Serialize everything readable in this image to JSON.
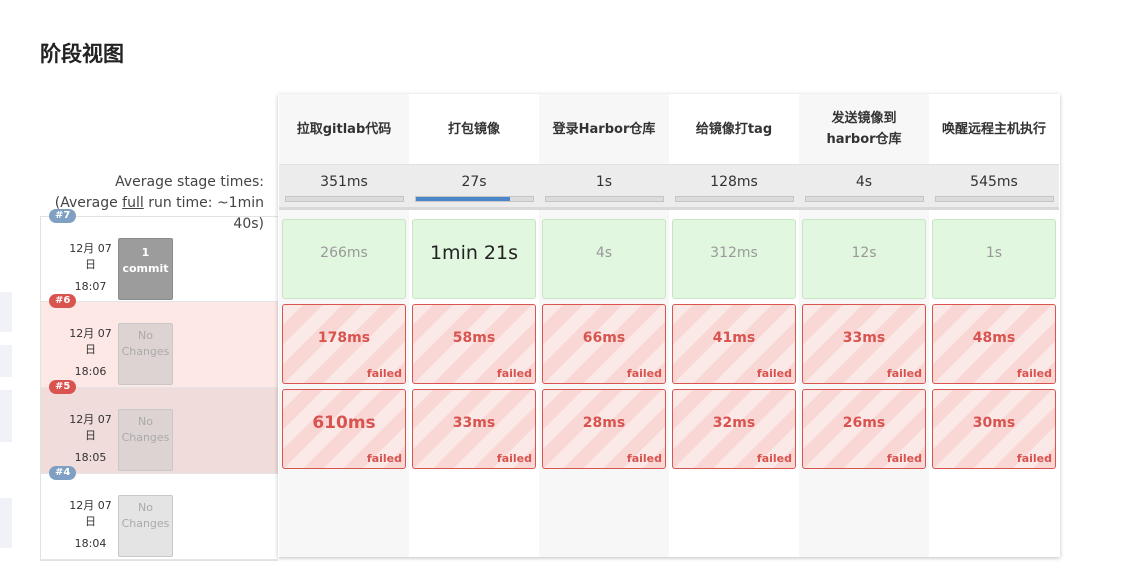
{
  "page_title": "阶段视图",
  "avg_label": {
    "line1": "Average stage times:",
    "line2_pre": "(Average ",
    "line2_link": "full",
    "line2_post": " run time: ~1min",
    "line3": "40s)"
  },
  "stages": [
    {
      "name": "拉取gitlab代码",
      "avg": "351ms",
      "avg_fraction": 0.0
    },
    {
      "name": "打包镜像",
      "avg": "27s",
      "avg_fraction": 0.8
    },
    {
      "name": "登录Harbor仓库",
      "avg": "1s",
      "avg_fraction": 0.0
    },
    {
      "name": "给镜像打tag",
      "avg": "128ms",
      "avg_fraction": 0.0
    },
    {
      "name": "发送镜像到harbor仓库",
      "avg": "4s",
      "avg_fraction": 0.0
    },
    {
      "name": "唤醒远程主机执行",
      "avg": "545ms",
      "avg_fraction": 0.0
    }
  ],
  "builds": [
    {
      "number": "#7",
      "date": "12月 07",
      "date2": "日",
      "time": "18:07",
      "changes": "1 commit",
      "status": "success",
      "stage_times": [
        "266ms",
        "1min 21s",
        "4s",
        "312ms",
        "12s",
        "1s"
      ]
    },
    {
      "number": "#6",
      "date": "12月 07",
      "date2": "日",
      "time": "18:06",
      "changes": "No Changes",
      "status": "failed",
      "stage_times": [
        "178ms",
        "58ms",
        "66ms",
        "41ms",
        "33ms",
        "48ms"
      ],
      "fail_label": "failed"
    },
    {
      "number": "#5",
      "date": "12月 07",
      "date2": "日",
      "time": "18:05",
      "changes": "No Changes",
      "status": "failed",
      "stage_times": [
        "610ms",
        "33ms",
        "28ms",
        "32ms",
        "26ms",
        "30ms"
      ],
      "fail_label": "failed"
    },
    {
      "number": "#4",
      "date": "12月 07",
      "date2": "日",
      "time": "18:04",
      "changes": "No Changes",
      "status": "none",
      "stage_times": []
    }
  ],
  "colors": {
    "success_bg": "#e2f7df",
    "fail_border": "#d9534f",
    "fail_bg": "#f8d7d5",
    "progress": "#4a86c8"
  }
}
